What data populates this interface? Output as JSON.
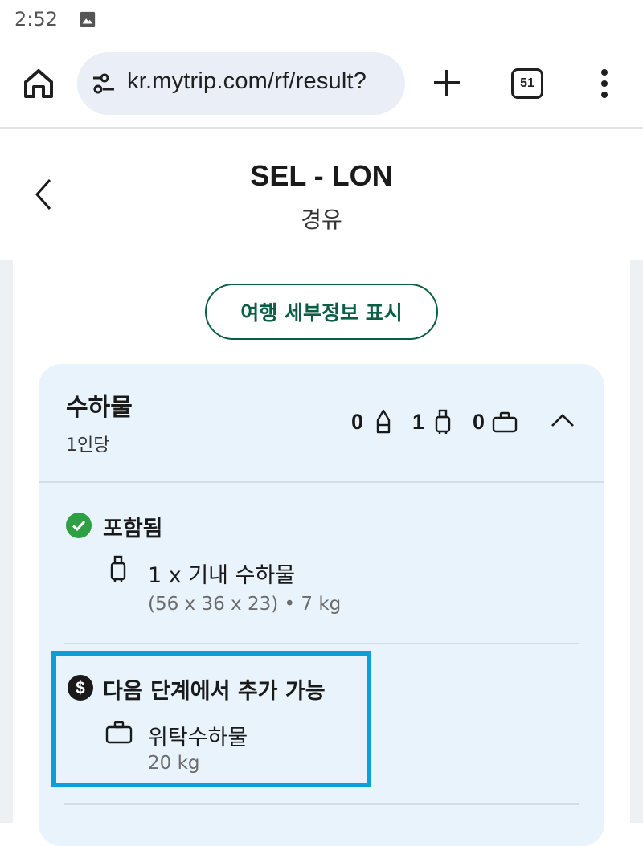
{
  "status_bar": {
    "time": "2:52",
    "icons": [
      "image-icon"
    ]
  },
  "browser": {
    "url": "kr.mytrip.com/rf/result?",
    "tab_count": "51",
    "icons": [
      "home-icon",
      "site-settings-icon",
      "plus-icon",
      "tabs-icon",
      "more-vert-icon"
    ]
  },
  "header": {
    "title": "SEL - LON",
    "subtitle": "경유"
  },
  "details_button": {
    "label": "여행 세부정보 표시"
  },
  "baggage": {
    "title": "수하물",
    "subtitle": "1인당",
    "counts": {
      "personal": "0",
      "cabin": "1",
      "checked": "0"
    },
    "included": {
      "title": "포함됨",
      "item_text": "1 x 기내 수하물",
      "item_detail": "(56 x 36 x 23) • 7 kg"
    },
    "addable": {
      "title": "다음 단계에서 추가 가능",
      "item_text": "위탁수하물",
      "item_detail": "20 kg"
    }
  },
  "colors": {
    "accent_green": "#0b5d45",
    "card_bg": "#e8f3fc",
    "check_green": "#2ea043",
    "highlight_blue": "#0b9fd8"
  }
}
